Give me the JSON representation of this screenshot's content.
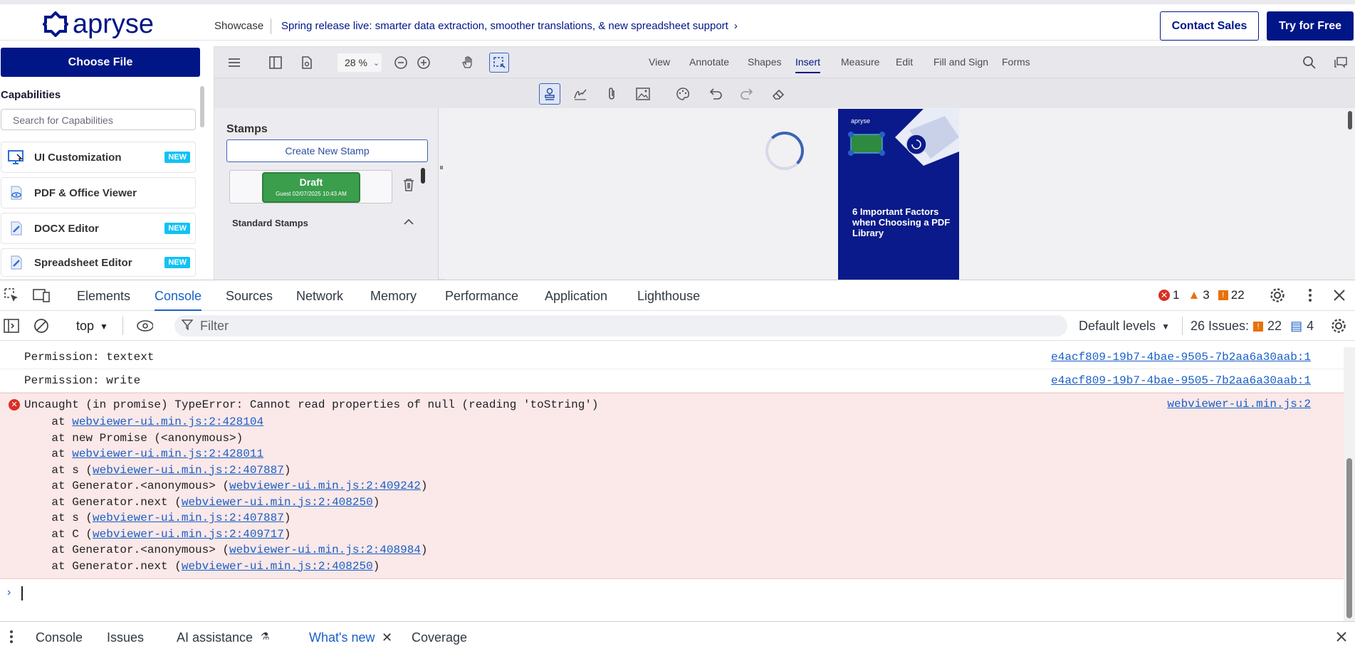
{
  "topbar": {
    "logo_text": "apryse",
    "showcase": "Showcase",
    "promo": "Spring release live: smarter data extraction, smoother translations, & new spreadsheet support",
    "contact_sales": "Contact Sales",
    "try_free": "Try for Free",
    "brand_color": "#001687"
  },
  "sidebar": {
    "choose_file": "Choose File",
    "capabilities_title": "Capabilities",
    "search_placeholder": "Search for Capabilities",
    "items": [
      {
        "label": "UI Customization",
        "badge": "NEW",
        "icon": "monitor-cursor-icon"
      },
      {
        "label": "PDF & Office Viewer",
        "badge": "",
        "icon": "document-eye-icon"
      },
      {
        "label": "DOCX Editor",
        "badge": "NEW",
        "icon": "document-pencil-icon"
      },
      {
        "label": "Spreadsheet Editor",
        "badge": "NEW",
        "icon": "document-pencil-icon"
      }
    ]
  },
  "viewer": {
    "zoom": "28 %",
    "menu": [
      "View",
      "Annotate",
      "Shapes",
      "Insert",
      "Measure",
      "Edit",
      "Fill and Sign",
      "Forms"
    ],
    "active_menu": "Insert",
    "stamps_title": "Stamps",
    "create_stamp": "Create New Stamp",
    "draft_label": "Draft",
    "draft_meta": "Guest 02/07/2025 10:43 AM",
    "standard_stamps": "Standard Stamps",
    "doc_logo": "apryse",
    "doc_title": "6 Important Factors when Choosing a PDF Library"
  },
  "devtools": {
    "tabs": [
      "Elements",
      "Console",
      "Sources",
      "Network",
      "Memory",
      "Performance",
      "Application",
      "Lighthouse"
    ],
    "active_tab": "Console",
    "errors": "1",
    "warnings": "3",
    "infos": "22",
    "context": "top",
    "filter_placeholder": "Filter",
    "levels": "Default levels",
    "issues_label": "26 Issues:",
    "issues_warn": "22",
    "issues_info": "4",
    "logs": [
      {
        "text": "Permission: textext",
        "src": "e4acf809-19b7-4bae-9505-7b2aa6a30aab:1"
      },
      {
        "text": "Permission: write",
        "src": "e4acf809-19b7-4bae-9505-7b2aa6a30aab:1"
      }
    ],
    "error": {
      "message": "Uncaught (in promise) TypeError: Cannot read properties of null (reading 'toString')",
      "src": "webviewer-ui.min.js:2",
      "stack": [
        {
          "pre": "    at ",
          "link": "webviewer-ui.min.js:2:428104",
          "post": ""
        },
        {
          "pre": "    at new Promise (<anonymous>)",
          "link": "",
          "post": ""
        },
        {
          "pre": "    at ",
          "link": "webviewer-ui.min.js:2:428011",
          "post": ""
        },
        {
          "pre": "    at s (",
          "link": "webviewer-ui.min.js:2:407887",
          "post": ")"
        },
        {
          "pre": "    at Generator.<anonymous> (",
          "link": "webviewer-ui.min.js:2:409242",
          "post": ")"
        },
        {
          "pre": "    at Generator.next (",
          "link": "webviewer-ui.min.js:2:408250",
          "post": ")"
        },
        {
          "pre": "    at s (",
          "link": "webviewer-ui.min.js:2:407887",
          "post": ")"
        },
        {
          "pre": "    at C (",
          "link": "webviewer-ui.min.js:2:409717",
          "post": ")"
        },
        {
          "pre": "    at Generator.<anonymous> (",
          "link": "webviewer-ui.min.js:2:408984",
          "post": ")"
        },
        {
          "pre": "    at Generator.next (",
          "link": "webviewer-ui.min.js:2:408250",
          "post": ")"
        }
      ]
    },
    "drawer_tabs": [
      "Console",
      "Issues",
      "AI assistance",
      "What's new",
      "Coverage"
    ],
    "active_drawer_tab": "What's new"
  }
}
